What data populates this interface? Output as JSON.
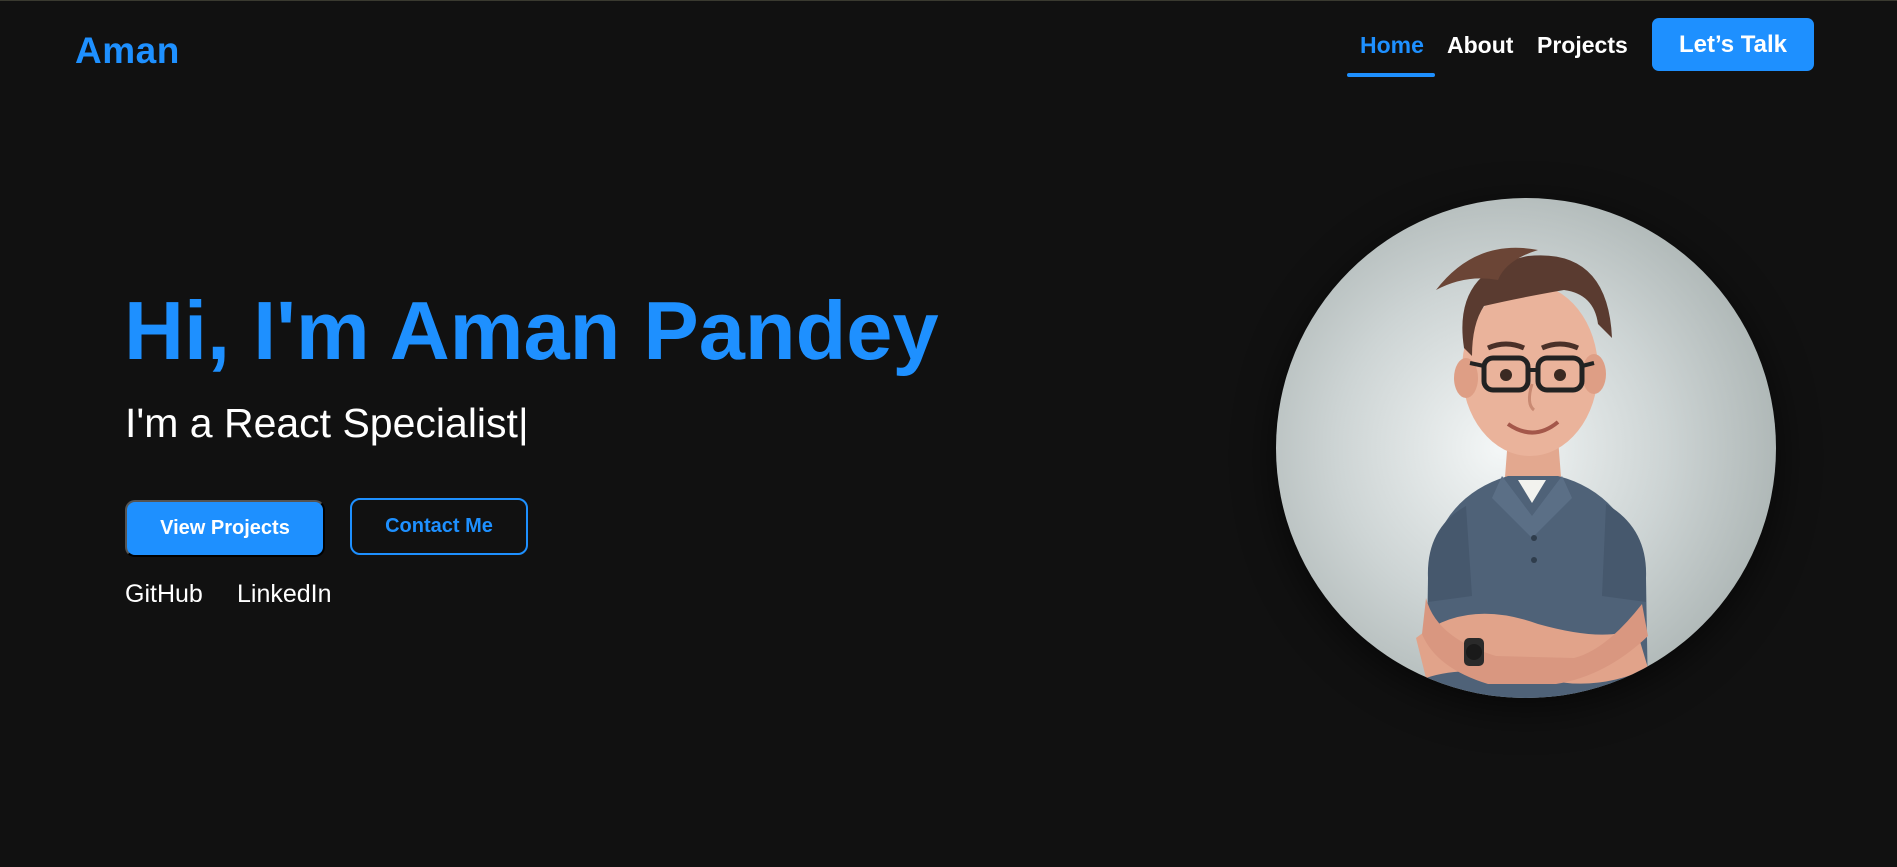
{
  "header": {
    "logo": "Aman",
    "nav": [
      {
        "label": "Home",
        "active": true
      },
      {
        "label": "About",
        "active": false
      },
      {
        "label": "Projects",
        "active": false
      }
    ],
    "cta_label": "Let’s Talk"
  },
  "hero": {
    "title": "Hi, I'm Aman Pandey",
    "subtitle": "I'm a React Specialist",
    "cursor": "|",
    "primary_button": "View Projects",
    "secondary_button": "Contact Me",
    "social_links": [
      "GitHub",
      "LinkedIn"
    ]
  },
  "avatar": {
    "icon": "cartoon-avatar-portrait"
  },
  "colors": {
    "accent": "#1e90ff",
    "background": "#111111",
    "text": "#ffffff"
  }
}
